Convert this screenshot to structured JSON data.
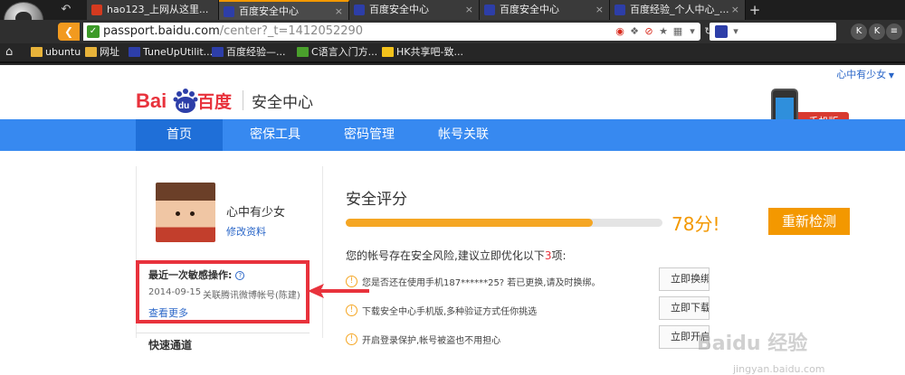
{
  "browser": {
    "tabs": [
      {
        "title": "hao123_上网从这里...",
        "icon": "hao123-icon"
      },
      {
        "title": "百度安全中心",
        "icon": "baidu-paw-icon",
        "active": true
      },
      {
        "title": "百度安全中心",
        "icon": "baidu-paw-icon"
      },
      {
        "title": "百度安全中心",
        "icon": "baidu-paw-icon"
      },
      {
        "title": "百度经验_个人中心_...",
        "icon": "baidu-paw-icon"
      }
    ],
    "tab_close_glyph": "×",
    "new_tab_glyph": "+",
    "back_glyph": "↶",
    "url": {
      "host": "passport.baidu.com",
      "path": "/center?_t=1412052290"
    },
    "bookmarks": [
      {
        "label": "ubuntu",
        "icon": "folder-icon"
      },
      {
        "label": "网址",
        "icon": "folder-icon"
      },
      {
        "label": "TuneUpUtilit...",
        "icon": "baidu-paw-icon"
      },
      {
        "label": "百度经验—...",
        "icon": "baidu-paw-icon"
      },
      {
        "label": "C语言入门方...",
        "icon": "green-icon"
      },
      {
        "label": "HK共享吧-致...",
        "icon": "yellow-icon"
      }
    ],
    "right_buttons": [
      "K",
      "K",
      "●",
      "≡"
    ]
  },
  "page": {
    "user_top_link": "心中有少女",
    "logo_subtitle": "安全中心",
    "phone_promo_label": "手机版",
    "nav": [
      {
        "label": "首页",
        "active": true
      },
      {
        "label": "密保工具"
      },
      {
        "label": "密码管理"
      },
      {
        "label": "帐号关联"
      }
    ],
    "profile": {
      "username": "心中有少女",
      "edit_link": "修改资料"
    },
    "recent": {
      "title": "最近一次敏感操作:",
      "help_glyph": "?",
      "date": "2014-09-15",
      "action": "关联腾讯微博帐号(陈建)",
      "more_link": "查看更多"
    },
    "left_next_label": "快速通道",
    "security": {
      "title": "安全评分",
      "score_text": "78分!",
      "score_fraction": 0.78,
      "recheck_label": "重新检测",
      "summary_prefix": "您的帐号存在安全风险,建议立即优化以下",
      "summary_count": "3",
      "summary_suffix": "项:",
      "items": [
        {
          "text": "您是否还在使用手机187******25? 若已更换,请及时换绑。",
          "button": "立即换绑"
        },
        {
          "text": "下载安全中心手机版,多种验证方式任你挑选",
          "button": "立即下载"
        },
        {
          "text": "开启登录保护,帐号被盗也不用担心",
          "button": "立即开启"
        }
      ]
    },
    "watermark": "Baidu 经验",
    "watermark_sub": "jingyan.baidu.com"
  },
  "colors": {
    "accent": "#f39800",
    "nav_blue": "#3789f0",
    "highlight_red": "#e8323c",
    "link_blue": "#2a66c8"
  }
}
